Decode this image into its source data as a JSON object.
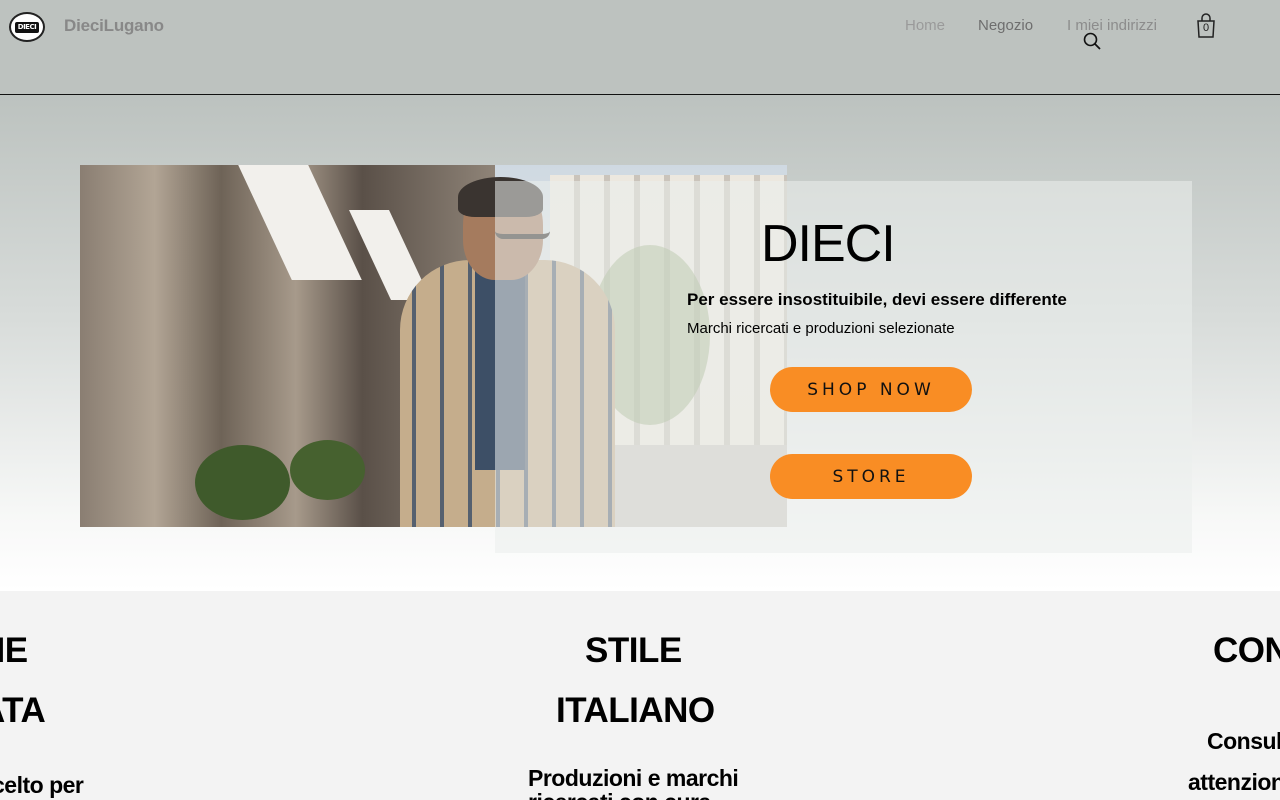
{
  "header": {
    "logo_text": "DIECI",
    "site_name": "DieciLugano",
    "nav": {
      "home": "Home",
      "shop": "Negozio",
      "addresses": "I miei indirizzi"
    },
    "cart_count": "0",
    "icons": [
      "search-icon",
      "shopping-bag-icon"
    ]
  },
  "hero": {
    "title": "DIECI",
    "tagline": "Per essere insostituibile, devi essere differente",
    "subtitle": "Marchi ricercati e produzioni selezionate",
    "shop_button": "SHOP NOW",
    "store_button": "STORE",
    "accent_color": "#f98d24"
  },
  "features": {
    "left": {
      "heading_line1": "NE",
      "heading_line2": "ATA",
      "text": "celto per"
    },
    "center": {
      "heading_line1": "STILE",
      "heading_line2": "ITALIANO",
      "text_line1": "Produzioni e marchi",
      "text_line2": "ricercati con cura"
    },
    "right": {
      "heading_line1": "CON",
      "text_line1": "Consul",
      "text_line2": "attenzion"
    }
  }
}
